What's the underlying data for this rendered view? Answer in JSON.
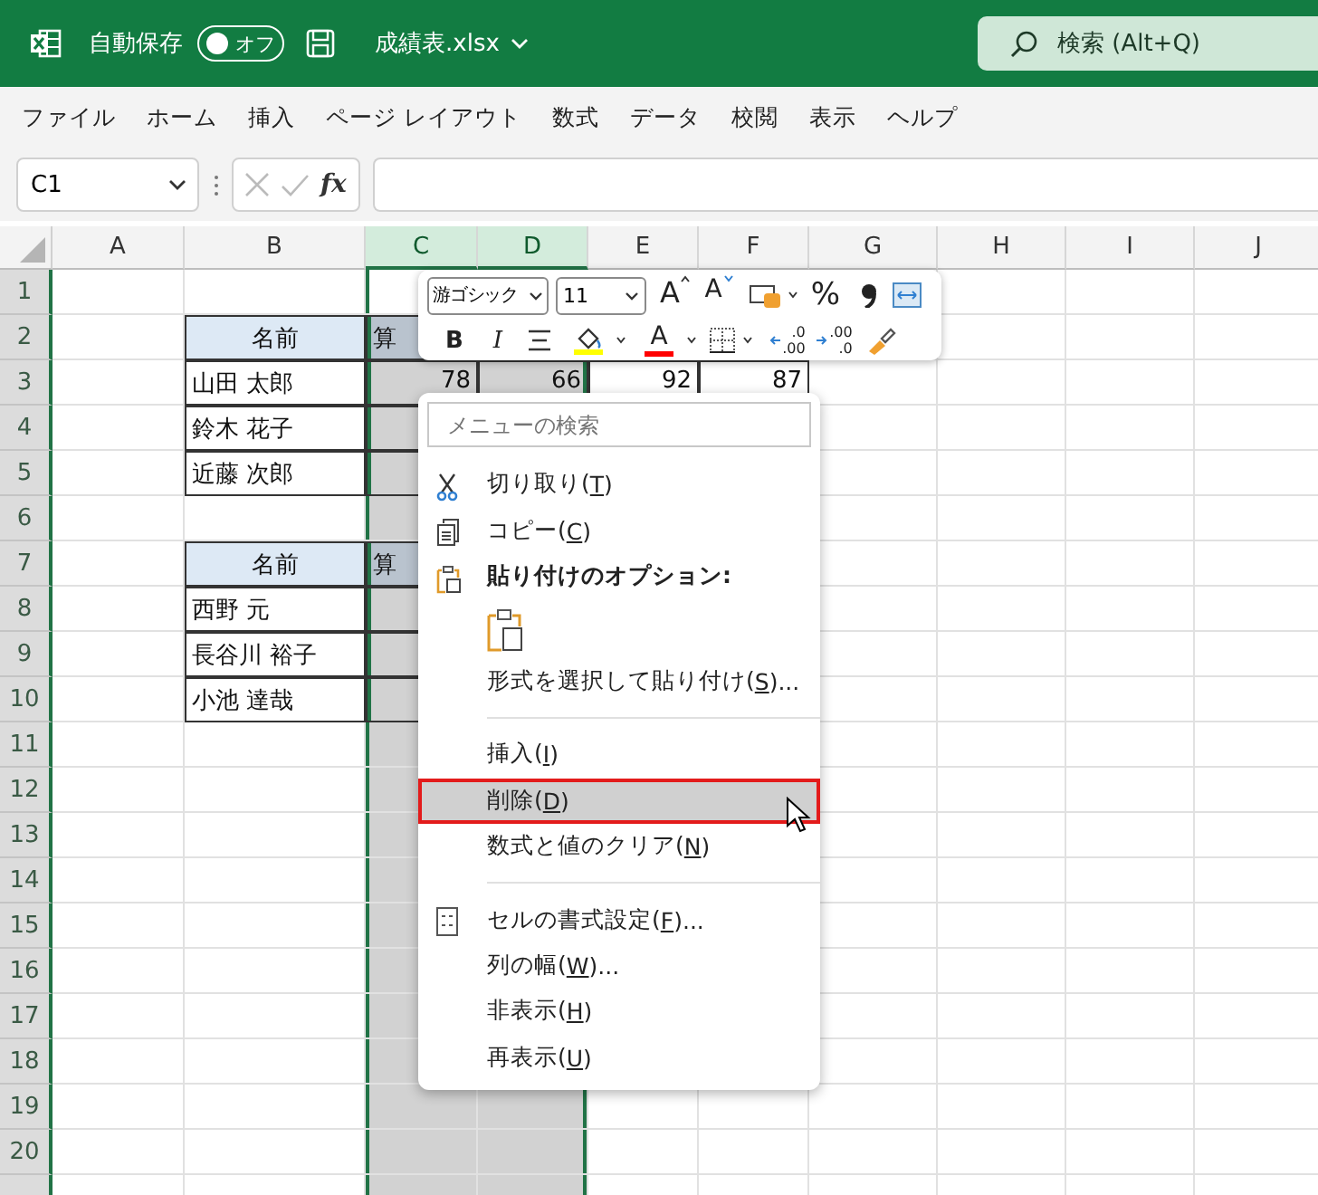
{
  "title_bar": {
    "autosave_label": "自動保存",
    "autosave": {
      "on": false,
      "label": "オフ"
    },
    "file_name": "成績表.xlsx",
    "search": {
      "placeholder": "検索 (Alt+Q)"
    }
  },
  "ribbon_tabs": [
    "ファイル",
    "ホーム",
    "挿入",
    "ページ レイアウト",
    "数式",
    "データ",
    "校閲",
    "表示",
    "ヘルプ"
  ],
  "formula_bar": {
    "name_box": "C1",
    "fx": "fx"
  },
  "sheet": {
    "columns": [
      {
        "label": "A",
        "selected": false
      },
      {
        "label": "B",
        "selected": false
      },
      {
        "label": "C",
        "selected": true
      },
      {
        "label": "D",
        "selected": true
      },
      {
        "label": "E",
        "selected": false
      },
      {
        "label": "F",
        "selected": false
      },
      {
        "label": "G",
        "selected": false
      },
      {
        "label": "H",
        "selected": false
      },
      {
        "label": "I",
        "selected": false
      },
      {
        "label": "J",
        "selected": false
      }
    ],
    "rows": [
      {
        "header": "1",
        "cells": [
          null,
          null,
          {
            "kind": "active"
          }
        ]
      },
      {
        "header": "2",
        "cells": [
          null,
          {
            "kind": "header",
            "text": "名前"
          },
          {
            "kind": "header",
            "text": "算"
          }
        ]
      },
      {
        "header": "3",
        "cells": [
          null,
          {
            "kind": "name",
            "text": "山田 太郎"
          },
          {
            "kind": "number",
            "text": "78"
          },
          {
            "kind": "number",
            "text": "66"
          },
          {
            "kind": "number",
            "text": "92"
          },
          {
            "kind": "number",
            "text": "87"
          }
        ]
      },
      {
        "header": "4",
        "cells": [
          null,
          {
            "kind": "name",
            "text": "鈴木 花子"
          },
          {
            "kind": "boxed"
          }
        ]
      },
      {
        "header": "5",
        "cells": [
          null,
          {
            "kind": "name",
            "text": "近藤 次郎"
          },
          {
            "kind": "boxed"
          }
        ]
      },
      {
        "header": "6",
        "cells": []
      },
      {
        "header": "7",
        "cells": [
          null,
          {
            "kind": "header",
            "text": "名前"
          },
          {
            "kind": "header",
            "text": "算"
          }
        ]
      },
      {
        "header": "8",
        "cells": [
          null,
          {
            "kind": "name",
            "text": "西野 元"
          },
          {
            "kind": "boxed"
          }
        ]
      },
      {
        "header": "9",
        "cells": [
          null,
          {
            "kind": "name",
            "text": "長谷川 裕子"
          },
          {
            "kind": "boxed"
          }
        ]
      },
      {
        "header": "10",
        "cells": [
          null,
          {
            "kind": "name",
            "text": "小池 達哉"
          },
          {
            "kind": "boxed"
          }
        ]
      },
      {
        "header": "11",
        "cells": []
      },
      {
        "header": "12",
        "cells": []
      },
      {
        "header": "13",
        "cells": []
      },
      {
        "header": "14",
        "cells": []
      },
      {
        "header": "15",
        "cells": []
      },
      {
        "header": "16",
        "cells": []
      },
      {
        "header": "17",
        "cells": []
      },
      {
        "header": "18",
        "cells": []
      },
      {
        "header": "19",
        "cells": []
      },
      {
        "header": "20",
        "cells": []
      }
    ]
  },
  "mini_toolbar": {
    "font_name": "游ゴシック",
    "font_size": "11",
    "row_1": [
      {
        "kind": "grow-font",
        "label": "A"
      },
      {
        "kind": "shrink-font",
        "label": "A"
      },
      {
        "kind": "number-format"
      },
      {
        "kind": "percent",
        "label": "%"
      },
      {
        "kind": "comma"
      },
      {
        "kind": "wrap"
      }
    ],
    "row_2": [
      {
        "kind": "bold",
        "label": "B"
      },
      {
        "kind": "italic",
        "label": "I"
      },
      {
        "kind": "align"
      },
      {
        "kind": "fill-color",
        "color": "#ffff00"
      },
      {
        "kind": "font-color",
        "label": "A",
        "color": "#ff0000"
      },
      {
        "kind": "borders"
      },
      {
        "kind": "increase-decimal",
        "lines": [
          ".0",
          ".00"
        ]
      },
      {
        "kind": "decrease-decimal",
        "lines": [
          ".00",
          ".0"
        ]
      },
      {
        "kind": "format-painter"
      }
    ]
  },
  "context_menu": {
    "search": {
      "placeholder": "メニューの検索"
    },
    "items": [
      {
        "kind": "cut",
        "label": "切り取り(",
        "key": "T",
        "tail": ")",
        "selected": false
      },
      {
        "kind": "copy",
        "label": "コピー(",
        "key": "C",
        "tail": ")",
        "selected": false
      },
      {
        "kind": "paste-heading",
        "label": "貼り付けのオプション:"
      },
      {
        "kind": "paste-icons"
      },
      {
        "kind": "command",
        "label": "形式を選択して貼り付け(",
        "key": "S",
        "tail": ")...",
        "selected": false
      },
      {
        "kind": "separator"
      },
      {
        "kind": "command",
        "label": "挿入(",
        "key": "I",
        "tail": ")",
        "selected": false
      },
      {
        "kind": "command",
        "label": "削除(",
        "key": "D",
        "tail": ")",
        "selected": true
      },
      {
        "kind": "command",
        "label": "数式と値のクリア(",
        "key": "N",
        "tail": ")",
        "selected": false
      },
      {
        "kind": "separator"
      },
      {
        "kind": "format-cells",
        "label": "セルの書式設定(",
        "key": "F",
        "tail": ")...",
        "selected": false
      },
      {
        "kind": "command",
        "label": "列の幅(",
        "key": "W",
        "tail": ")...",
        "selected": false
      },
      {
        "kind": "command",
        "label": "非表示(",
        "key": "H",
        "tail": ")",
        "selected": false
      },
      {
        "kind": "command",
        "label": "再表示(",
        "key": "U",
        "tail": ")",
        "selected": false
      }
    ]
  }
}
